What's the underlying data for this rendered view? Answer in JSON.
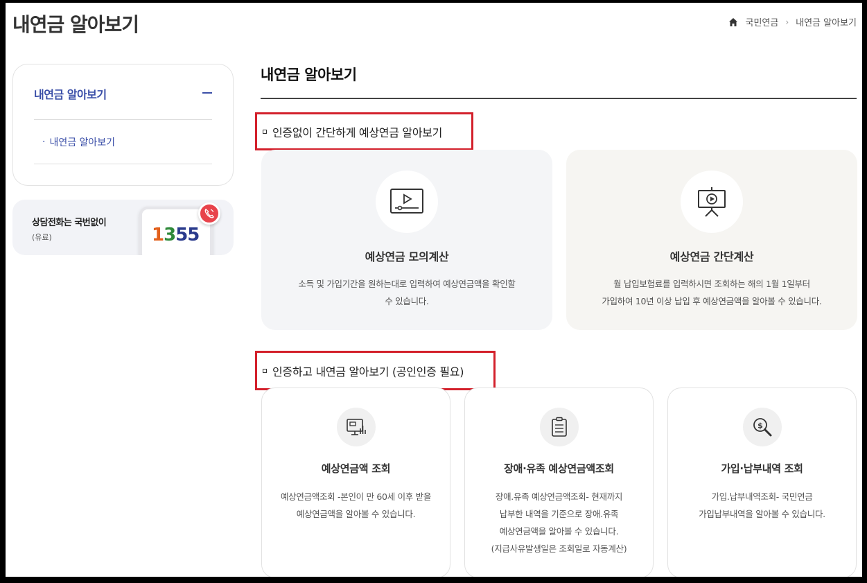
{
  "header": {
    "page_title": "내연금 알아보기",
    "breadcrumb": [
      "국민연금",
      "내연금 알아보기"
    ]
  },
  "sidebar": {
    "menu_title": "내연금 알아보기",
    "sub_item": "내연금 알아보기",
    "call": {
      "title": "상담전화는 국번없이",
      "sub": "(유료)",
      "digits": [
        "1",
        "3",
        "5",
        "5"
      ],
      "digit_colors": [
        "#e2601c",
        "#2f8a3a",
        "#2a3a8c",
        "#2a3a8c"
      ]
    }
  },
  "main": {
    "title": "내연금 알아보기",
    "section1": {
      "heading": "인증없이 간단하게 예상연금 알아보기",
      "cards": [
        {
          "icon": "video-player-icon",
          "title": "예상연금 모의계산",
          "desc_lines": [
            "소득 및 가입기간을 원하는대로 입력하여 예상연금액을 확인할",
            "수 있습니다."
          ]
        },
        {
          "icon": "presentation-play-icon",
          "title": "예상연금 간단계산",
          "desc_lines": [
            "월 납입보험료를 입력하시면 조회하는 해의 1월 1일부터",
            "가입하여 10년 이상 납입 후 예상연금액을 알아볼 수 있습니다."
          ]
        }
      ]
    },
    "section2": {
      "heading": "인증하고 내연금 알아보기 (공인인증 필요)",
      "cards": [
        {
          "icon": "monitor-chart-icon",
          "title": "예상연금액 조회",
          "desc_lines": [
            "예상연금액조회 -본인이 만 60세 이후 받을",
            "예상연금액을 알아볼 수 있습니다."
          ]
        },
        {
          "icon": "document-list-icon",
          "title": "장애·유족 예상연금액조회",
          "desc_lines": [
            "장애.유족 예상연금액조회- 현재까지",
            "납부한 내역을 기준으로 장애.유족",
            "예상연금액을 알아볼 수 있습니다.",
            "(지급사유발생일은 조회일로 자동계산)"
          ]
        },
        {
          "icon": "money-search-icon",
          "title": "가입·납부내역 조회",
          "desc_lines": [
            "가입.납부내역조회- 국민연금",
            "가입납부내역을 알아볼 수 있습니다."
          ]
        }
      ]
    }
  }
}
